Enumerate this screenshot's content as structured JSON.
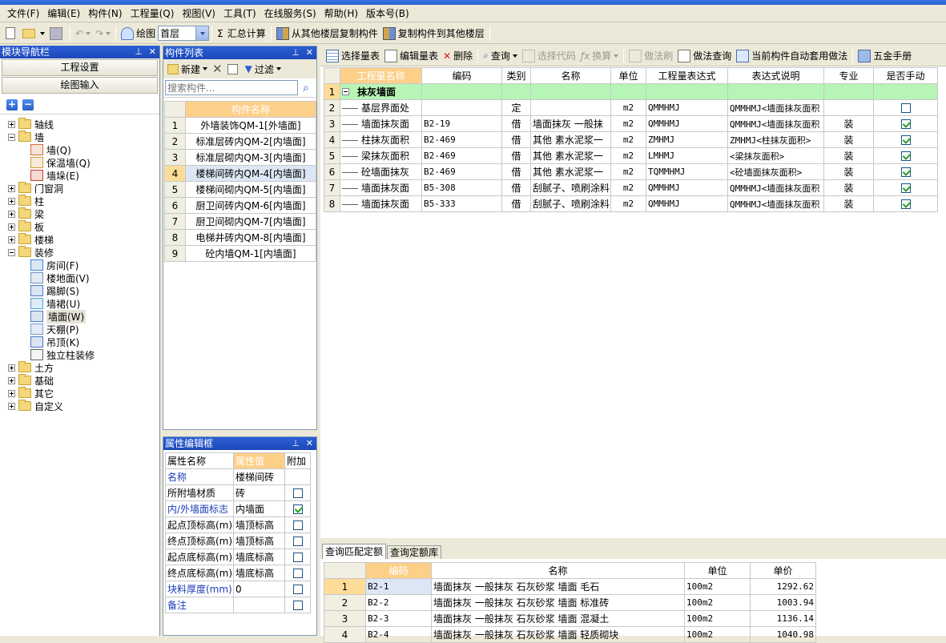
{
  "menu": [
    "文件(F)",
    "编辑(E)",
    "构件(N)",
    "工程量(Q)",
    "视图(V)",
    "工具(T)",
    "在线服务(S)",
    "帮助(H)",
    "版本号(B)"
  ],
  "toolbar": {
    "draw_label": "绘图",
    "floor_value": "首层",
    "sum_label": "汇总计算",
    "copy_from_label": "从其他楼层复制构件",
    "copy_to_label": "复制构件到其他楼层"
  },
  "nav": {
    "title": "模块导航栏",
    "btn_settings": "工程设置",
    "btn_draw_input": "绘图输入",
    "tree": [
      {
        "label": "轴线",
        "level": 0,
        "state": "plus"
      },
      {
        "label": "墙",
        "level": 0,
        "state": "minus"
      },
      {
        "label": "墙(Q)",
        "level": 1
      },
      {
        "label": "保温墙(Q)",
        "level": 1
      },
      {
        "label": "墙垛(E)",
        "level": 1
      },
      {
        "label": "门窗洞",
        "level": 0,
        "state": "plus"
      },
      {
        "label": "柱",
        "level": 0,
        "state": "plus"
      },
      {
        "label": "梁",
        "level": 0,
        "state": "plus"
      },
      {
        "label": "板",
        "level": 0,
        "state": "plus"
      },
      {
        "label": "楼梯",
        "level": 0,
        "state": "plus"
      },
      {
        "label": "装修",
        "level": 0,
        "state": "minus"
      },
      {
        "label": "房间(F)",
        "level": 1
      },
      {
        "label": "楼地面(V)",
        "level": 1
      },
      {
        "label": "踢脚(S)",
        "level": 1
      },
      {
        "label": "墙裙(U)",
        "level": 1
      },
      {
        "label": "墙面(W)",
        "level": 1,
        "selected": true
      },
      {
        "label": "天棚(P)",
        "level": 1
      },
      {
        "label": "吊顶(K)",
        "level": 1
      },
      {
        "label": "独立柱装修",
        "level": 1
      },
      {
        "label": "土方",
        "level": 0,
        "state": "plus"
      },
      {
        "label": "基础",
        "level": 0,
        "state": "plus"
      },
      {
        "label": "其它",
        "level": 0,
        "state": "plus"
      },
      {
        "label": "自定义",
        "level": 0,
        "state": "plus"
      }
    ]
  },
  "complist": {
    "title": "构件列表",
    "new_label": "新建",
    "filter_label": "过滤",
    "search_placeholder": "搜索构件...",
    "col_name": "构件名称",
    "rows": [
      "外墙装饰QM-1[外墙面]",
      "标准层砖内QM-2[内墙面]",
      "标准层砌内QM-3[内墙面]",
      "楼梯间砖内QM-4[内墙面]",
      "楼梯间砌内QM-5[内墙面]",
      "厨卫间砖内QM-6[内墙面]",
      "厨卫间砌内QM-7[内墙面]",
      "电梯井砖内QM-8[内墙面]",
      "砼内墙QM-1[内墙面]"
    ],
    "selected_row": 4
  },
  "props": {
    "title": "属性编辑框",
    "col_name": "属性名称",
    "col_value": "属性值",
    "col_extra": "附加",
    "rows": [
      {
        "name": "名称",
        "value": "楼梯间砖",
        "blue": true,
        "check": null
      },
      {
        "name": "所附墙材质",
        "value": "砖",
        "blue": false,
        "check": false
      },
      {
        "name": "内/外墙面标志",
        "value": "内墙面",
        "blue": true,
        "check": true
      },
      {
        "name": "起点顶标高(m)",
        "value": "墙顶标高",
        "blue": false,
        "check": false
      },
      {
        "name": "终点顶标高(m)",
        "value": "墙顶标高",
        "blue": false,
        "check": false
      },
      {
        "name": "起点底标高(m)",
        "value": "墙底标高",
        "blue": false,
        "check": false
      },
      {
        "name": "终点底标高(m)",
        "value": "墙底标高",
        "blue": false,
        "check": false
      },
      {
        "name": "块料厚度(mm)",
        "value": "0",
        "blue": true,
        "check": false
      },
      {
        "name": "备注",
        "value": "",
        "blue": true,
        "check": false
      }
    ]
  },
  "main_toolbar": {
    "select_table": "选择量表",
    "edit_table": "编辑量表",
    "delete": "删除",
    "query": "查询",
    "select_code": "选择代码",
    "convert": "换算",
    "method_brush": "做法刷",
    "method_query": "做法查询",
    "auto_apply": "当前构件自动套用做法",
    "hardware_manual": "五金手册"
  },
  "grid": {
    "columns": [
      "工程量名称",
      "编码",
      "类别",
      "名称",
      "单位",
      "工程量表达式",
      "表达式说明",
      "专业",
      "是否手动"
    ],
    "group": "抹灰墙面",
    "rows": [
      {
        "name": "基层界面处",
        "code": "",
        "cat": "定",
        "title": "",
        "unit": "m2",
        "expr": "QMMHMJ",
        "desc": "QMMHMJ<墙面抹灰面积",
        "major": "",
        "manual": false
      },
      {
        "name": "墙面抹灰面",
        "code": "B2-19",
        "cat": "借",
        "title": "墙面抹灰 一般抹",
        "unit": "m2",
        "expr": "QMMHMJ",
        "desc": "QMMHMJ<墙面抹灰面积",
        "major": "装",
        "manual": true
      },
      {
        "name": "柱抹灰面积",
        "code": "B2-469",
        "cat": "借",
        "title": "其他 素水泥浆一",
        "unit": "m2",
        "expr": "ZMHMJ",
        "desc": "ZMHMJ<柱抹灰面积>",
        "major": "装",
        "manual": true
      },
      {
        "name": "梁抹灰面积",
        "code": "B2-469",
        "cat": "借",
        "title": "其他 素水泥浆一",
        "unit": "m2",
        "expr": "LMHMJ",
        "desc": "<梁抹灰面积>",
        "major": "装",
        "manual": true
      },
      {
        "name": "砼墙面抹灰",
        "code": "B2-469",
        "cat": "借",
        "title": "其他 素水泥浆一",
        "unit": "m2",
        "expr": "TQMMHMJ",
        "desc": "<砼墙面抹灰面积>",
        "major": "装",
        "manual": true
      },
      {
        "name": "墙面抹灰面",
        "code": "B5-308",
        "cat": "借",
        "title": "刮腻子、喷刷涂料",
        "unit": "m2",
        "expr": "QMMHMJ",
        "desc": "QMMHMJ<墙面抹灰面积",
        "major": "装",
        "manual": true
      },
      {
        "name": "墙面抹灰面",
        "code": "B5-333",
        "cat": "借",
        "title": "刮腻子、喷刷涂料",
        "unit": "m2",
        "expr": "QMMHMJ",
        "desc": "QMMHMJ<墙面抹灰面积",
        "major": "装",
        "manual": true
      }
    ]
  },
  "bottom": {
    "tab1": "查询匹配定额",
    "tab2": "查询定额库",
    "columns": [
      "编码",
      "名称",
      "单位",
      "单价"
    ],
    "rows": [
      {
        "code": "B2-1",
        "name": "墙面抹灰 一般抹灰 石灰砂浆 墙面 毛石",
        "unit": "100m2",
        "price": "1292.62"
      },
      {
        "code": "B2-2",
        "name": "墙面抹灰 一般抹灰 石灰砂浆 墙面 标准砖",
        "unit": "100m2",
        "price": "1003.94"
      },
      {
        "code": "B2-3",
        "name": "墙面抹灰 一般抹灰 石灰砂浆 墙面 混凝土",
        "unit": "100m2",
        "price": "1136.14"
      },
      {
        "code": "B2-4",
        "name": "墙面抹灰 一般抹灰 石灰砂浆 墙面 轻质砌块",
        "unit": "100m2",
        "price": "1040.98"
      }
    ]
  },
  "colors": {
    "accent_header": "#fdd08a",
    "selection": "#fddc98",
    "group_row": "#b6f5b6",
    "panel_title": "#2c5fd6"
  }
}
